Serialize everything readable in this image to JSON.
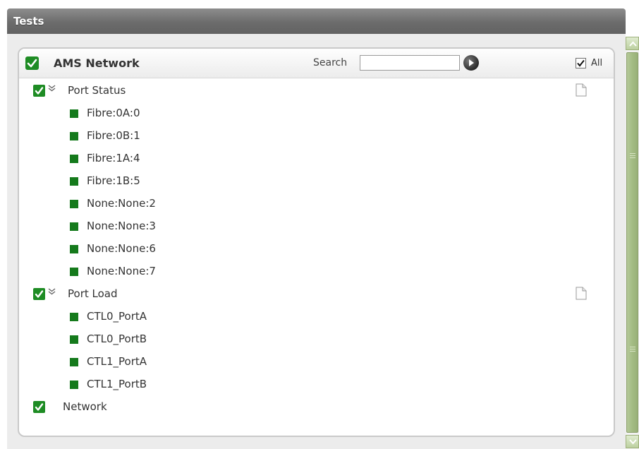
{
  "window": {
    "title": "Tests"
  },
  "panel": {
    "title": "AMS Network",
    "search_label": "Search",
    "search_value": "",
    "search_placeholder": "",
    "all_label": "All",
    "all_checked": true
  },
  "tree": {
    "groups": [
      {
        "label": "Port Status",
        "checked": true,
        "expanded": true,
        "items": [
          "Fibre:0A:0",
          "Fibre:0B:1",
          "Fibre:1A:4",
          "Fibre:1B:5",
          "None:None:2",
          "None:None:3",
          "None:None:6",
          "None:None:7"
        ]
      },
      {
        "label": "Port Load",
        "checked": true,
        "expanded": true,
        "items": [
          "CTL0_PortA",
          "CTL0_PortB",
          "CTL1_PortA",
          "CTL1_PortB"
        ]
      },
      {
        "label": "Network",
        "checked": true,
        "expanded": false,
        "items": []
      }
    ]
  },
  "colors": {
    "accent_green": "#1e8c24",
    "status_green": "#157a1c",
    "title_bar": "#6c6c6c",
    "scroll_thumb": "#a4bc84"
  },
  "icons": {
    "header_check": "checkmark-icon",
    "go": "arrow-right-icon",
    "document": "document-icon",
    "expand": "double-chevron-down-icon",
    "status": "green-square-icon"
  }
}
